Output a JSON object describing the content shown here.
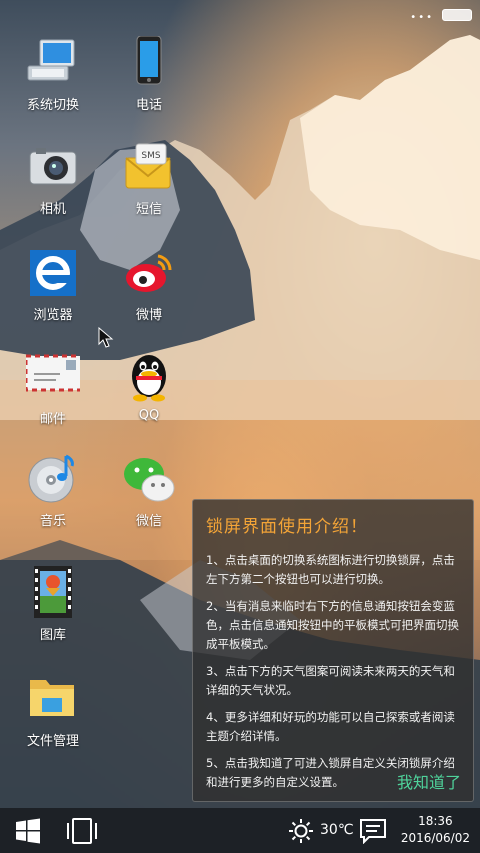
{
  "status_bar": {
    "dots": "•••",
    "battery_icon": "battery-icon"
  },
  "desktop_icons": [
    {
      "label": "系统切换",
      "icon": "computer-switch-icon"
    },
    {
      "label": "电话",
      "icon": "phone-icon"
    },
    {
      "label": "相机",
      "icon": "camera-icon"
    },
    {
      "label": "短信",
      "icon": "sms-icon"
    },
    {
      "label": "浏览器",
      "icon": "browser-icon"
    },
    {
      "label": "微博",
      "icon": "weibo-icon"
    },
    {
      "label": "邮件",
      "icon": "mail-icon"
    },
    {
      "label": "QQ",
      "icon": "qq-icon"
    },
    {
      "label": "音乐",
      "icon": "music-icon"
    },
    {
      "label": "微信",
      "icon": "wechat-icon"
    },
    {
      "label": "图库",
      "icon": "gallery-icon"
    },
    {
      "label": "文件管理",
      "icon": "folder-icon"
    }
  ],
  "sms_badge": "SMS",
  "tip_panel": {
    "title": "锁屏界面使用介绍！",
    "items": [
      "1、点击桌面的切换系统图标进行切换锁屏，点击左下方第二个按钮也可以进行切换。",
      "2、当有消息来临时右下方的信息通知按钮会变蓝色，点击信息通知按钮中的平板模式可把界面切换成平板模式。",
      "3、点击下方的天气图案可阅读未来两天的天气和详细的天气状况。",
      "4、更多详细和好玩的功能可以自己探索或者阅读主题介绍详情。",
      "5、点击我知道了可进入锁屏自定义关闭锁屏介绍和进行更多的自定义设置。"
    ],
    "ok_label": "我知道了"
  },
  "taskbar": {
    "start_icon": "windows-start-icon",
    "switch_icon": "tablet-switch-icon",
    "weather_icon": "sun-icon",
    "temperature": "30℃",
    "notification_icon": "message-icon",
    "time": "18:36",
    "date": "2016/06/02"
  },
  "colors": {
    "tip_title": "#f3a437",
    "tip_ok": "#4fd39b",
    "taskbar_bg": "#1d2126"
  }
}
